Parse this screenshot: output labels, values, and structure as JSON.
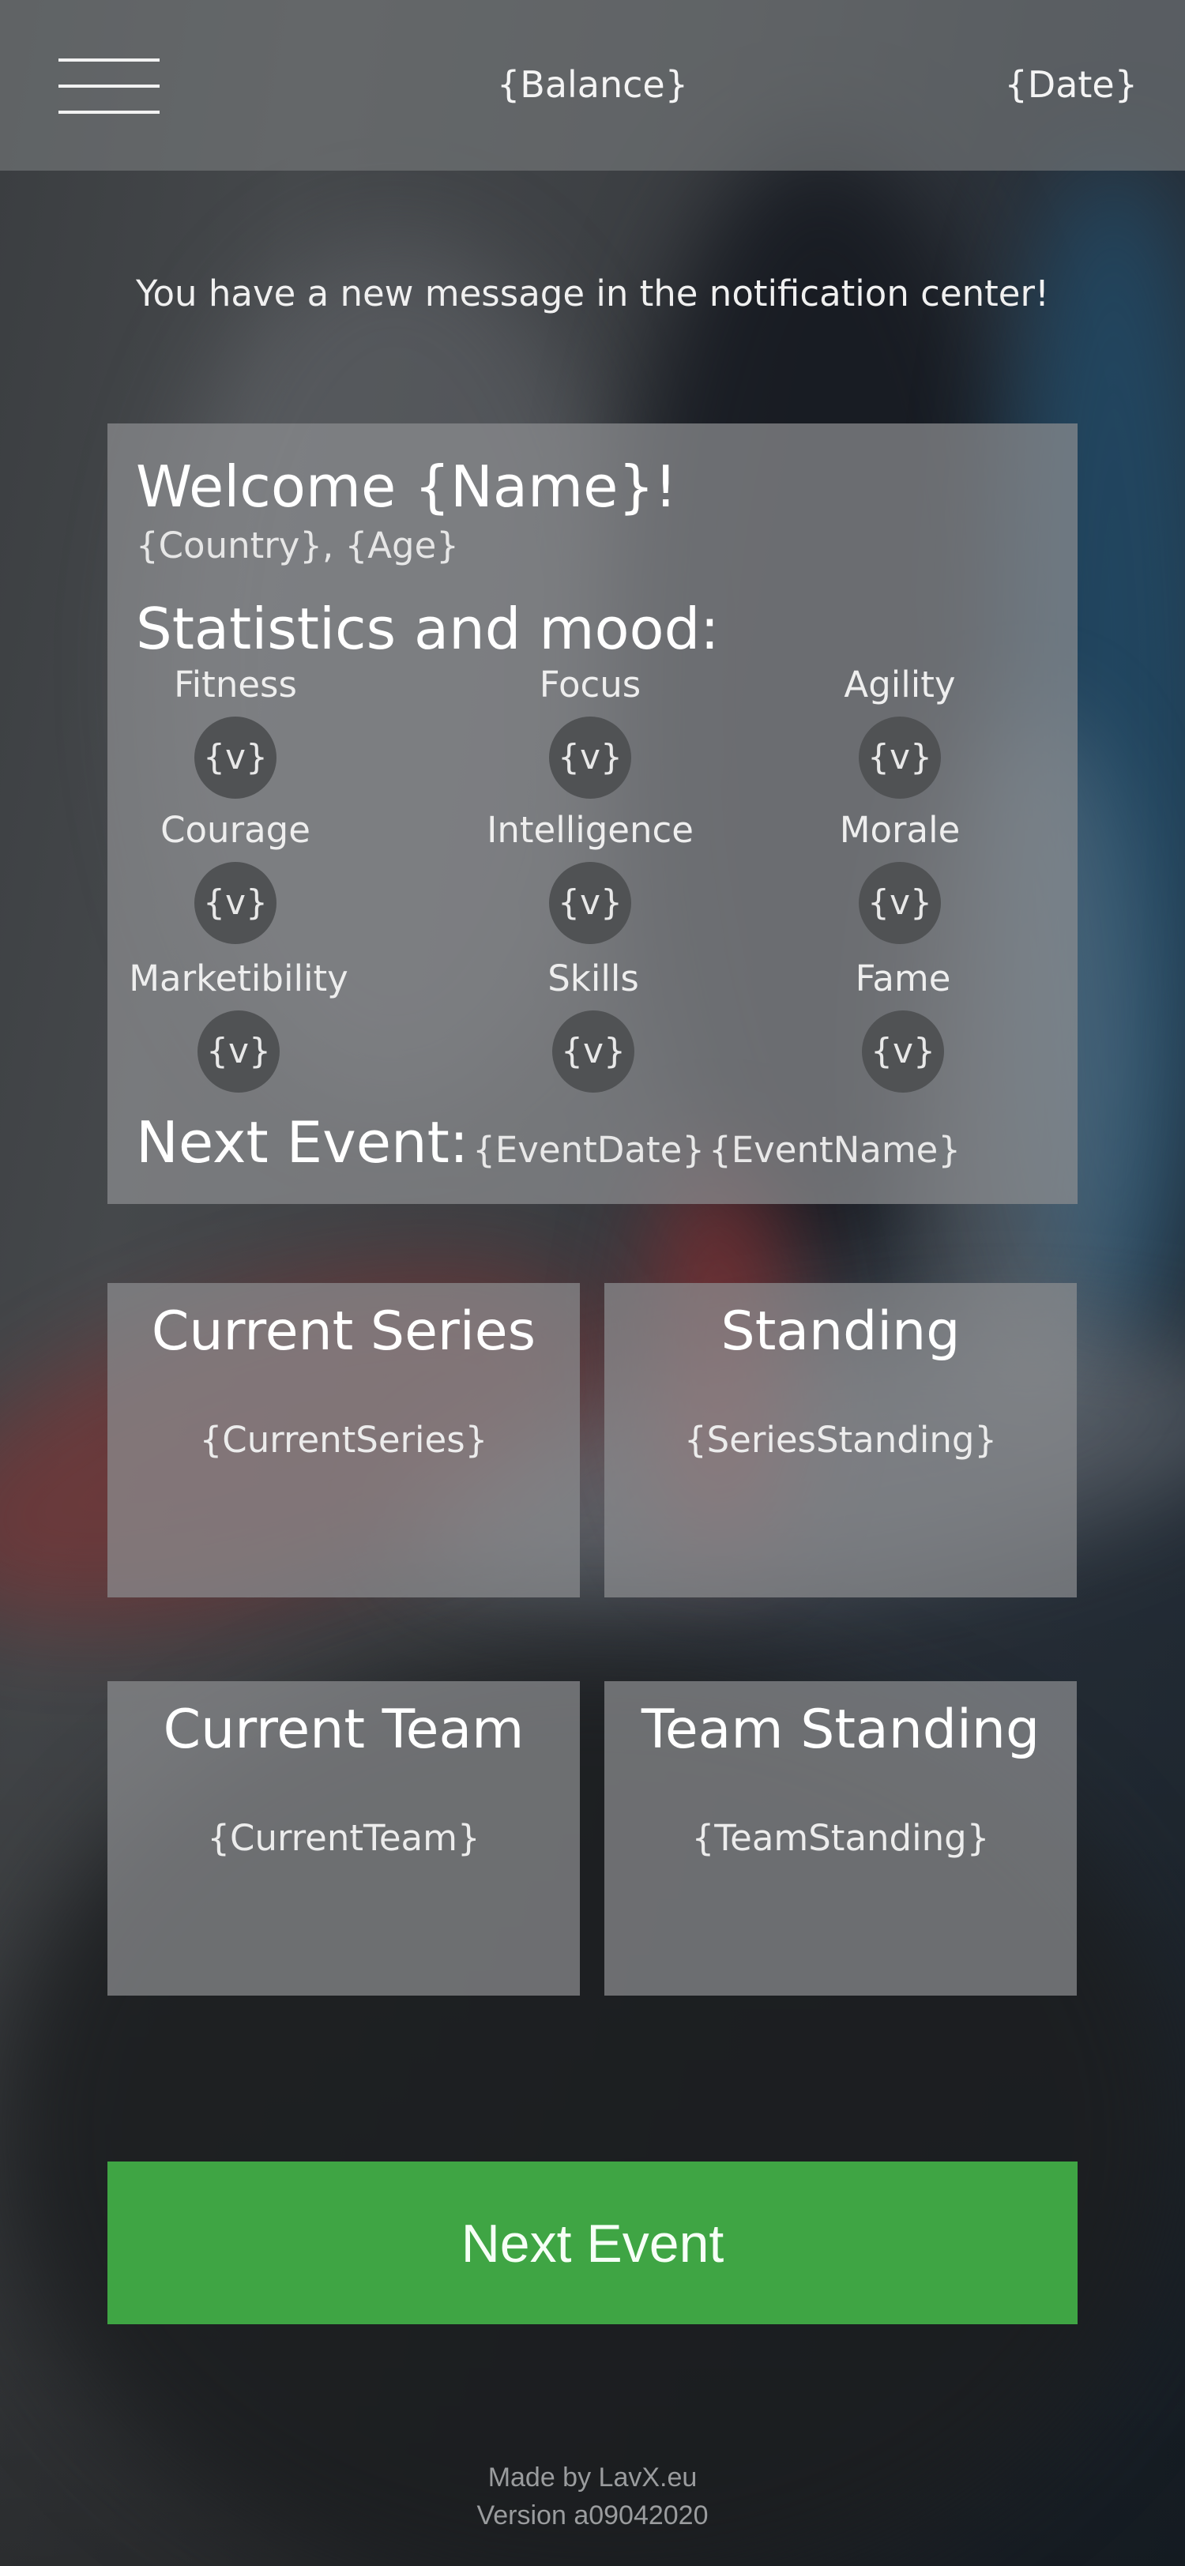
{
  "header": {
    "balance": "{Balance}",
    "date": "{Date}",
    "menu_icon": "hamburger-menu-icon"
  },
  "notification": "You have a new message in the notification center!",
  "welcome": {
    "title": "Welcome {Name}!",
    "subtitle": "{Country}, {Age}"
  },
  "stats": {
    "title": "Statistics and mood:",
    "items": [
      {
        "label": "Fitness",
        "value": "{v}"
      },
      {
        "label": "Focus",
        "value": "{v}"
      },
      {
        "label": "Agility",
        "value": "{v}"
      },
      {
        "label": "Courage",
        "value": "{v}"
      },
      {
        "label": "Intelligence",
        "value": "{v}"
      },
      {
        "label": "Morale",
        "value": "{v}"
      },
      {
        "label": "Marketibility",
        "value": "{v}"
      },
      {
        "label": "Skills",
        "value": "{v}"
      },
      {
        "label": "Fame",
        "value": "{v}"
      }
    ]
  },
  "next_event": {
    "label": "Next Event:",
    "date": "{EventDate}",
    "name": "{EventName}"
  },
  "tiles": [
    {
      "title": "Current Series",
      "value": "{CurrentSeries}"
    },
    {
      "title": "Standing",
      "value": "{SeriesStanding}"
    },
    {
      "title": "Current Team",
      "value": "{CurrentTeam}"
    },
    {
      "title": "Team Standing",
      "value": "{TeamStanding}"
    }
  ],
  "cta": {
    "label": "Next Event",
    "color": "#3fa544"
  },
  "footer": {
    "made_by": "Made by LavX.eu",
    "version": "Version a09042020"
  }
}
